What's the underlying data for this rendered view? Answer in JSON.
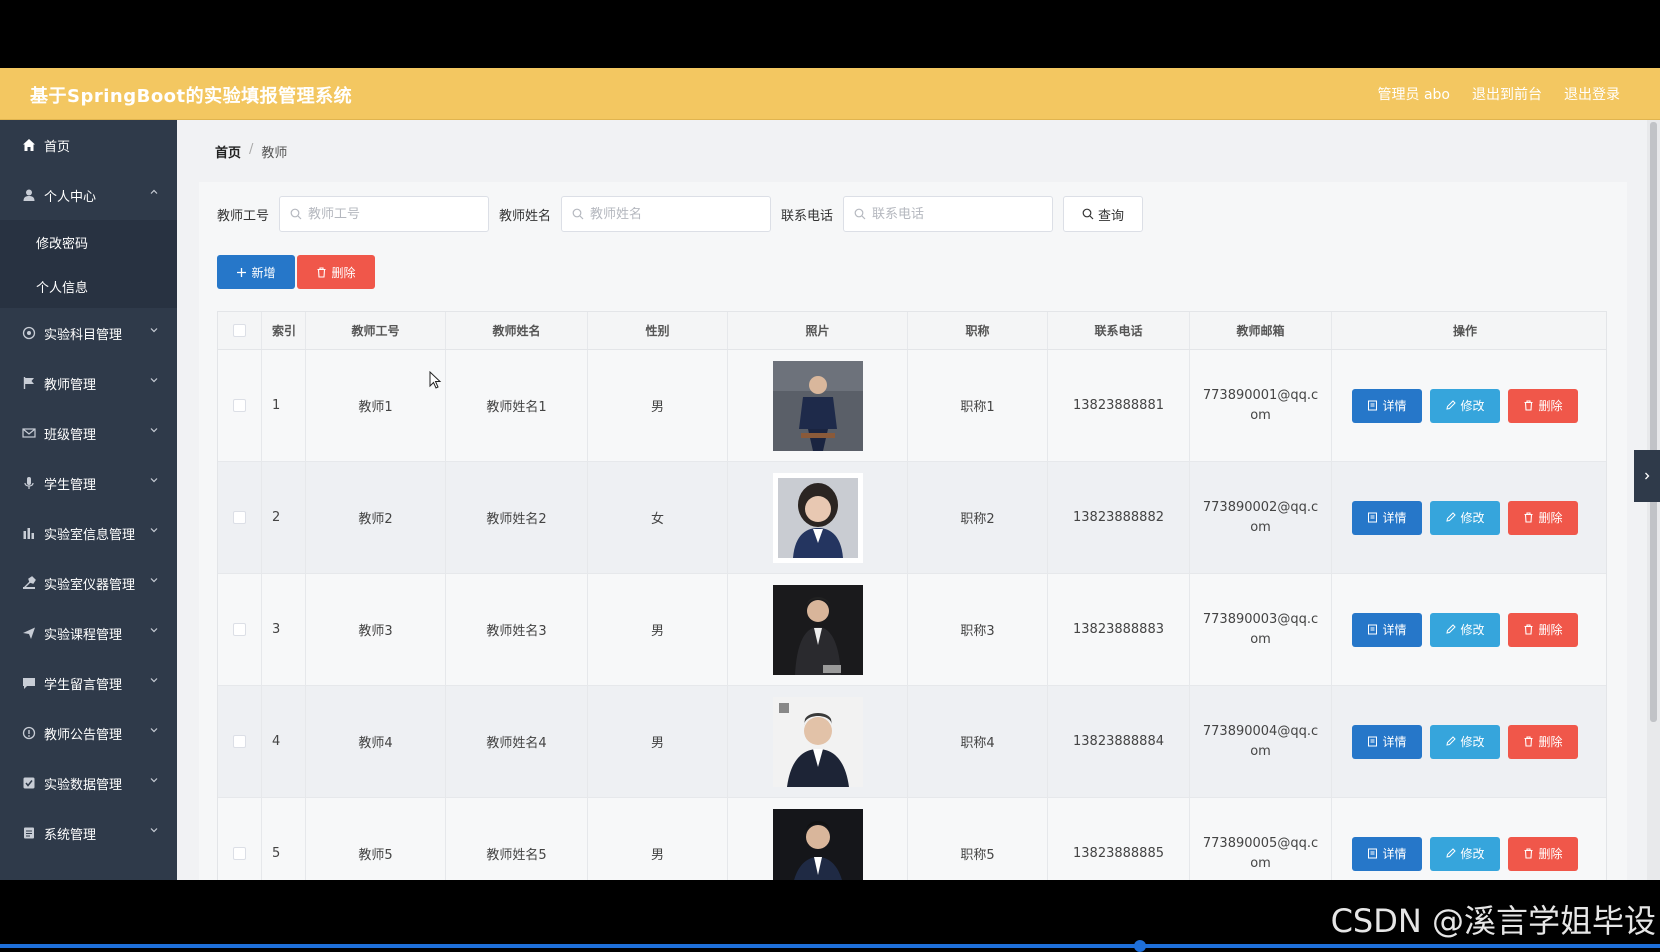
{
  "header": {
    "title": "基于SpringBoot的实验填报管理系统",
    "admin": "管理员 abo",
    "to_front": "退出到前台",
    "logout": "退出登录"
  },
  "sidebar": {
    "items": [
      {
        "label": "首页",
        "icon": "home-icon"
      },
      {
        "label": "个人中心",
        "icon": "user-icon",
        "expanded": true
      },
      {
        "label": "实验科目管理",
        "icon": "circle-icon"
      },
      {
        "label": "教师管理",
        "icon": "flag-icon"
      },
      {
        "label": "班级管理",
        "icon": "mail-icon"
      },
      {
        "label": "学生管理",
        "icon": "mic-icon"
      },
      {
        "label": "实验室信息管理",
        "icon": "chart-icon"
      },
      {
        "label": "实验室仪器管理",
        "icon": "tool-icon"
      },
      {
        "label": "实验课程管理",
        "icon": "send-icon"
      },
      {
        "label": "学生留言管理",
        "icon": "message-icon"
      },
      {
        "label": "教师公告管理",
        "icon": "info-icon"
      },
      {
        "label": "实验数据管理",
        "icon": "check-icon"
      },
      {
        "label": "系统管理",
        "icon": "list-icon"
      }
    ],
    "submenu": [
      "修改密码",
      "个人信息"
    ]
  },
  "breadcrumb": {
    "home": "首页",
    "sep": "/",
    "current": "教师"
  },
  "search": {
    "no_label": "教师工号",
    "no_placeholder": "教师工号",
    "name_label": "教师姓名",
    "name_placeholder": "教师姓名",
    "phone_label": "联系电话",
    "phone_placeholder": "联系电话",
    "query": "查询"
  },
  "actions": {
    "add": "新增",
    "delete": "删除"
  },
  "table": {
    "headers": [
      "索引",
      "教师工号",
      "教师姓名",
      "性别",
      "照片",
      "职称",
      "联系电话",
      "教师邮箱",
      "操作"
    ],
    "ops": {
      "detail": "详情",
      "edit": "修改",
      "delete": "删除"
    },
    "rows": [
      {
        "idx": "1",
        "no": "教师1",
        "name": "教师姓名1",
        "sex": "男",
        "title": "职称1",
        "phone": "13823888881",
        "email": "773890001@qq.com"
      },
      {
        "idx": "2",
        "no": "教师2",
        "name": "教师姓名2",
        "sex": "女",
        "title": "职称2",
        "phone": "13823888882",
        "email": "773890002@qq.com"
      },
      {
        "idx": "3",
        "no": "教师3",
        "name": "教师姓名3",
        "sex": "男",
        "title": "职称3",
        "phone": "13823888883",
        "email": "773890003@qq.com"
      },
      {
        "idx": "4",
        "no": "教师4",
        "name": "教师姓名4",
        "sex": "男",
        "title": "职称4",
        "phone": "13823888884",
        "email": "773890004@qq.com"
      },
      {
        "idx": "5",
        "no": "教师5",
        "name": "教师姓名5",
        "sex": "男",
        "title": "职称5",
        "phone": "13823888885",
        "email": "773890005@qq.com"
      }
    ]
  },
  "watermark": "CSDN @溪言学姐毕设",
  "colors": {
    "header": "#f3c761",
    "sidebar": "#2f3a4a",
    "primary": "#2677c9",
    "info": "#36a5dc",
    "danger": "#f0574a"
  }
}
